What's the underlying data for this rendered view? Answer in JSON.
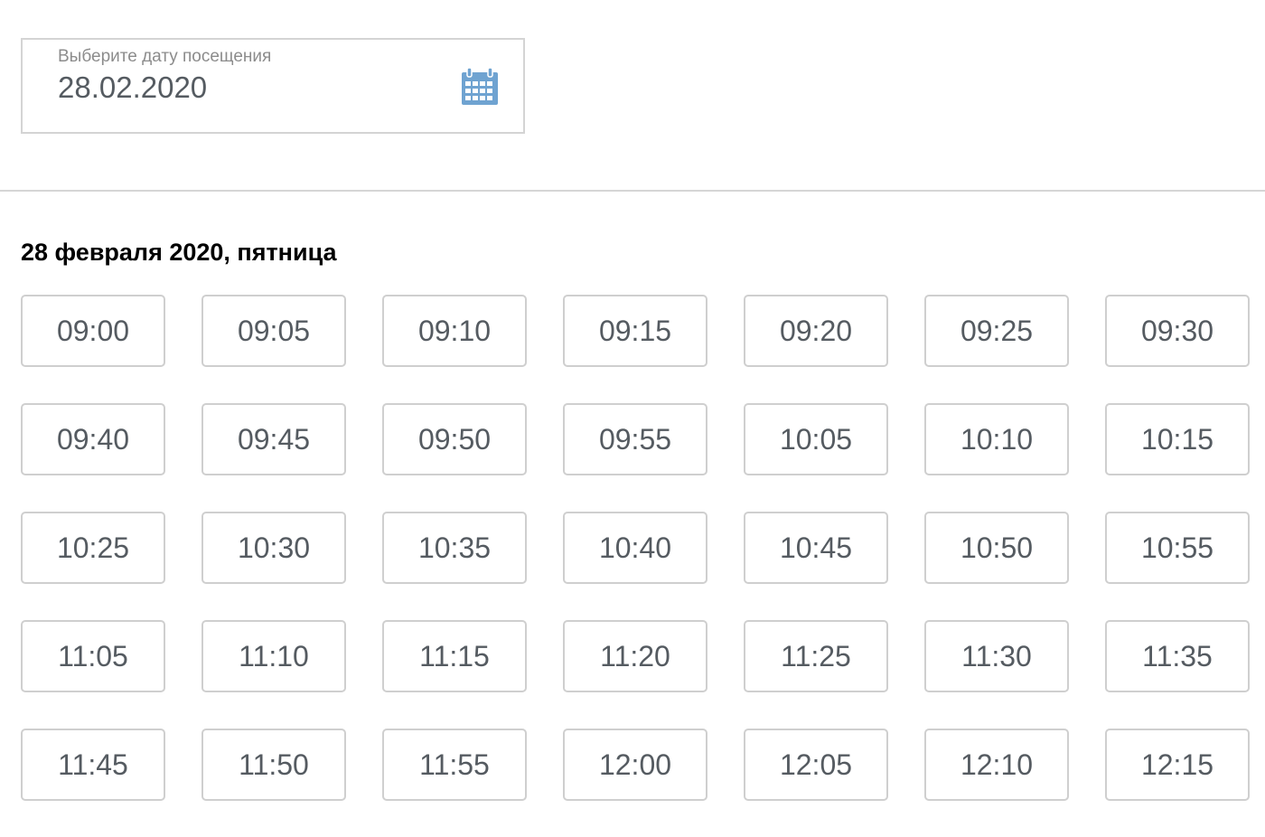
{
  "date_picker": {
    "label": "Выберите дату посещения",
    "value": "28.02.2020",
    "icon": "calendar-icon",
    "icon_color": "#6fa3d1"
  },
  "schedule": {
    "day_heading": "28 февраля 2020, пятница",
    "slots": [
      "09:00",
      "09:05",
      "09:10",
      "09:15",
      "09:20",
      "09:25",
      "09:30",
      "09:40",
      "09:45",
      "09:50",
      "09:55",
      "10:05",
      "10:10",
      "10:15",
      "10:25",
      "10:30",
      "10:35",
      "10:40",
      "10:45",
      "10:50",
      "10:55",
      "11:05",
      "11:10",
      "11:15",
      "11:20",
      "11:25",
      "11:30",
      "11:35",
      "11:45",
      "11:50",
      "11:55",
      "12:00",
      "12:05",
      "12:10",
      "12:15"
    ]
  }
}
